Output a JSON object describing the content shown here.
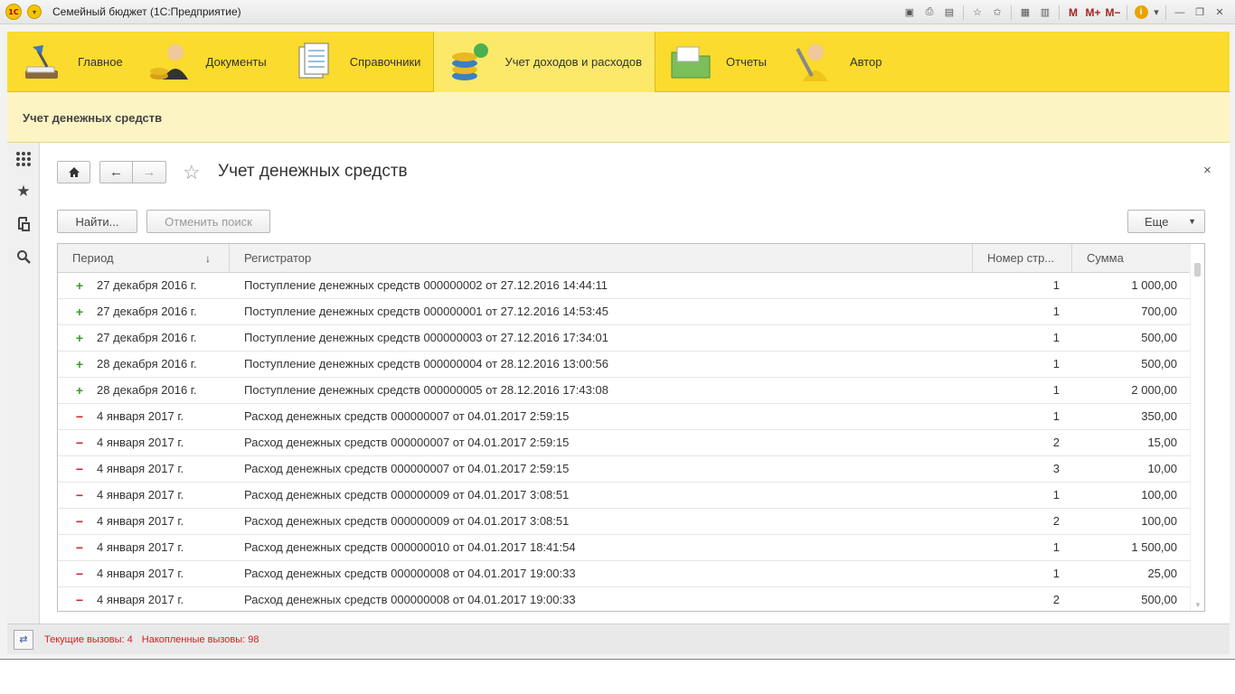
{
  "window": {
    "title": "Семейный бюджет  (1С:Предприятие)",
    "logo_text": "1С"
  },
  "titlebar_tools": {
    "m": "M",
    "m_plus": "M+",
    "m_minus": "M−",
    "info": "i"
  },
  "sections": [
    {
      "label": "Главное",
      "icon": "desk-lamp-icon"
    },
    {
      "label": "Документы",
      "icon": "person-coins-icon"
    },
    {
      "label": "Справочники",
      "icon": "documents-icon"
    },
    {
      "label": "Учет доходов и расходов",
      "icon": "coin-stack-icon",
      "active": true
    },
    {
      "label": "Отчеты",
      "icon": "folder-icon"
    },
    {
      "label": "Автор",
      "icon": "worker-icon"
    }
  ],
  "subheader": {
    "title": "Учет денежных средств"
  },
  "form": {
    "title": "Учет денежных средств",
    "find_label": "Найти...",
    "cancel_search_label": "Отменить поиск",
    "more_label": "Еще",
    "close": "×"
  },
  "table": {
    "columns": [
      "Период",
      "Регистратор",
      "Номер стр...",
      "Сумма"
    ],
    "rows": [
      {
        "type": "plus",
        "period": "27 декабря 2016 г.",
        "registrator": "Поступление денежных средств 000000002 от 27.12.2016 14:44:11",
        "line": "1",
        "sum": "1 000,00"
      },
      {
        "type": "plus",
        "period": "27 декабря 2016 г.",
        "registrator": "Поступление денежных средств 000000001 от 27.12.2016 14:53:45",
        "line": "1",
        "sum": "700,00"
      },
      {
        "type": "plus",
        "period": "27 декабря 2016 г.",
        "registrator": "Поступление денежных средств 000000003 от 27.12.2016 17:34:01",
        "line": "1",
        "sum": "500,00"
      },
      {
        "type": "plus",
        "period": "28 декабря 2016 г.",
        "registrator": "Поступление денежных средств 000000004 от 28.12.2016 13:00:56",
        "line": "1",
        "sum": "500,00"
      },
      {
        "type": "plus",
        "period": "28 декабря 2016 г.",
        "registrator": "Поступление денежных средств 000000005 от 28.12.2016 17:43:08",
        "line": "1",
        "sum": "2 000,00"
      },
      {
        "type": "minus",
        "period": "4 января 2017 г.",
        "registrator": "Расход денежных средств 000000007 от 04.01.2017 2:59:15",
        "line": "1",
        "sum": "350,00"
      },
      {
        "type": "minus",
        "period": "4 января 2017 г.",
        "registrator": "Расход денежных средств 000000007 от 04.01.2017 2:59:15",
        "line": "2",
        "sum": "15,00"
      },
      {
        "type": "minus",
        "period": "4 января 2017 г.",
        "registrator": "Расход денежных средств 000000007 от 04.01.2017 2:59:15",
        "line": "3",
        "sum": "10,00"
      },
      {
        "type": "minus",
        "period": "4 января 2017 г.",
        "registrator": "Расход денежных средств 000000009 от 04.01.2017 3:08:51",
        "line": "1",
        "sum": "100,00"
      },
      {
        "type": "minus",
        "period": "4 января 2017 г.",
        "registrator": "Расход денежных средств 000000009 от 04.01.2017 3:08:51",
        "line": "2",
        "sum": "100,00"
      },
      {
        "type": "minus",
        "period": "4 января 2017 г.",
        "registrator": "Расход денежных средств 000000010 от 04.01.2017 18:41:54",
        "line": "1",
        "sum": "1 500,00"
      },
      {
        "type": "minus",
        "period": "4 января 2017 г.",
        "registrator": "Расход денежных средств 000000008 от 04.01.2017 19:00:33",
        "line": "1",
        "sum": "25,00"
      },
      {
        "type": "minus",
        "period": "4 января 2017 г.",
        "registrator": "Расход денежных средств 000000008 от 04.01.2017 19:00:33",
        "line": "2",
        "sum": "500,00"
      }
    ]
  },
  "statusbar": {
    "current_calls": "Текущие вызовы: 4",
    "accumulated_calls": "Накопленные вызовы: 98"
  },
  "colors": {
    "sections_bg": "#fbdb2d",
    "subheader_bg": "#fdf4c4",
    "plus": "#3c9b2a",
    "minus": "#d02525",
    "status_text": "#d32020"
  }
}
